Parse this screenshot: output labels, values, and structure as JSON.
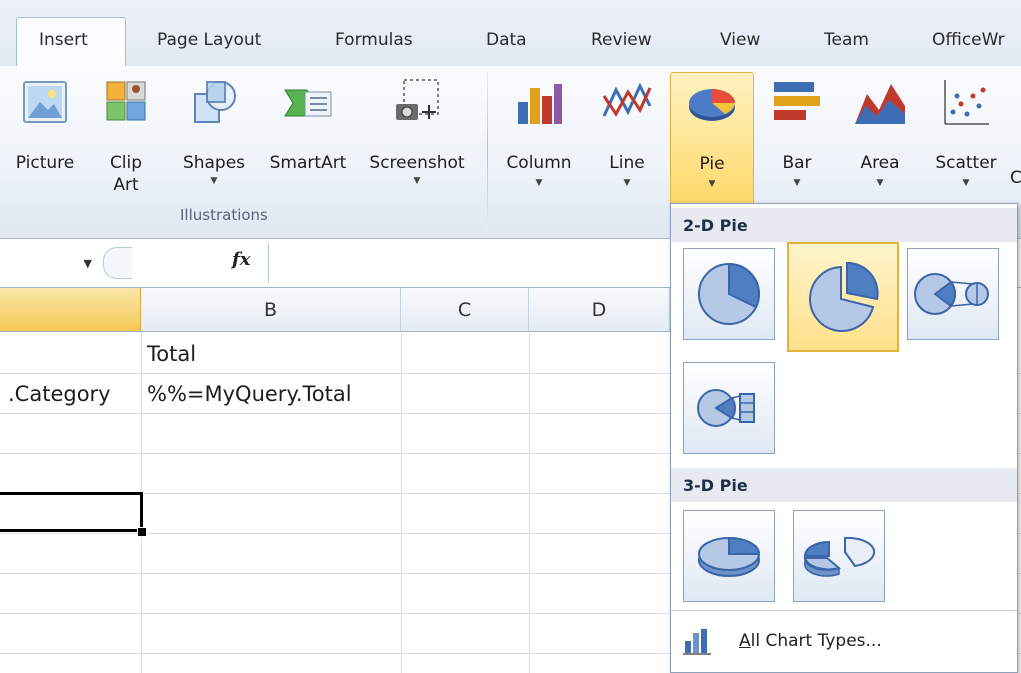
{
  "tabs": [
    "Insert",
    "Page Layout",
    "Formulas",
    "Data",
    "Review",
    "View",
    "Team",
    "OfficeWr"
  ],
  "ribbon": {
    "illustrations": {
      "group_label": "Illustrations",
      "buttons": [
        {
          "label": "Picture",
          "icon": "picture-icon"
        },
        {
          "label_line1": "Clip",
          "label_line2": "Art",
          "icon": "clip-art-icon"
        },
        {
          "label": "Shapes",
          "icon": "shapes-icon"
        },
        {
          "label": "SmartArt",
          "icon": "smartart-icon"
        },
        {
          "label": "Screenshot",
          "icon": "screenshot-icon"
        }
      ]
    },
    "charts": {
      "buttons": [
        {
          "label": "Column",
          "icon": "column-chart-icon"
        },
        {
          "label": "Line",
          "icon": "line-chart-icon"
        },
        {
          "label": "Pie",
          "icon": "pie-chart-icon",
          "selected": true
        },
        {
          "label": "Bar",
          "icon": "bar-chart-icon"
        },
        {
          "label": "Area",
          "icon": "area-chart-icon"
        },
        {
          "label": "Scatter",
          "icon": "scatter-chart-icon"
        }
      ],
      "cutoff_label": "C"
    }
  },
  "formula_bar": {
    "fx": "fx",
    "value": ""
  },
  "columns": [
    "B",
    "C",
    "D"
  ],
  "cells": {
    "b1": "Total",
    "a2": ".Category",
    "b2": "%%=MyQuery.Total"
  },
  "pie_menu": {
    "section_2d": "2-D Pie",
    "section_3d": "3-D Pie",
    "footer_accel": "A",
    "footer_rest": "ll Chart Types...",
    "selected_item": "exploded-pie"
  },
  "colors": {
    "pie_fill": "#a9c0e2",
    "pie_dark": "#3a65a8",
    "selected_fill": "#ffe18a"
  }
}
